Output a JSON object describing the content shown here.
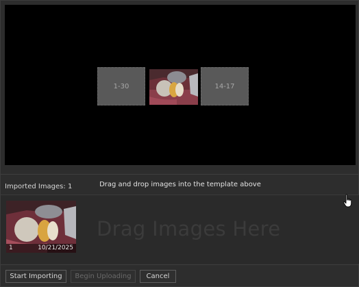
{
  "template": {
    "slots": [
      {
        "label": "1-30"
      },
      {
        "label": "14-17"
      }
    ]
  },
  "imported": {
    "label": "Imported Images: 1"
  },
  "hint": "Drag and drop images into the template above",
  "drop_zone": {
    "placeholder": "Drag Images Here"
  },
  "thumbnails": [
    {
      "number": "1",
      "date": "10/21/2025"
    }
  ],
  "buttons": {
    "start_importing": "Start Importing",
    "begin_uploading": "Begin Uploading",
    "cancel": "Cancel"
  },
  "colors": {
    "background": "#2d2d2d",
    "template_bg": "#000000",
    "slot_bg": "#595959",
    "disabled_text": "#6a6a6a"
  },
  "icons": {
    "cursor": "hand-pointer-icon"
  }
}
